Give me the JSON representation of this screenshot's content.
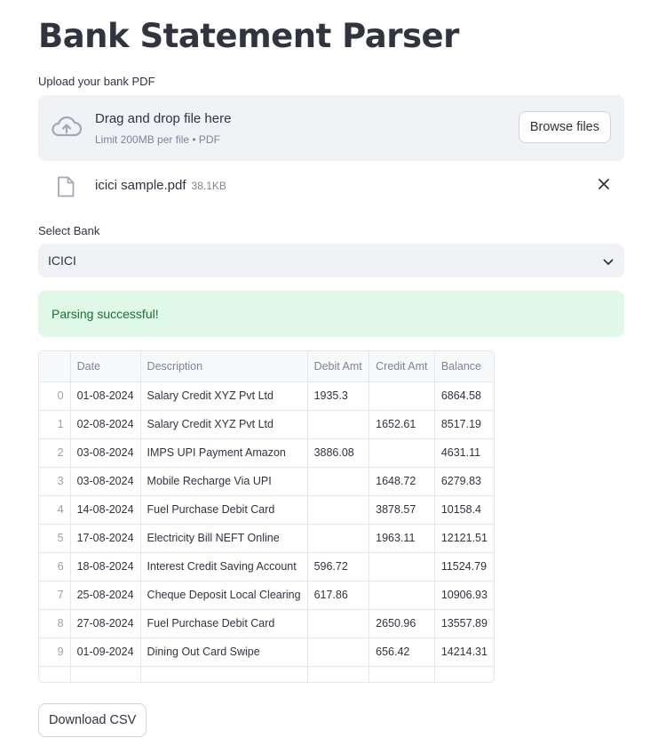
{
  "page": {
    "title": "Bank Statement Parser"
  },
  "upload": {
    "label": "Upload your bank PDF",
    "drag_text": "Drag and drop file here",
    "limit_text": "Limit 200MB per file • PDF",
    "browse_label": "Browse files",
    "file": {
      "name": "icici sample.pdf",
      "size": "38.1KB"
    }
  },
  "bank_select": {
    "label": "Select Bank",
    "value": "ICICI"
  },
  "status": {
    "message": "Parsing successful!"
  },
  "table": {
    "columns": [
      "",
      "Date",
      "Description",
      "Debit Amt",
      "Credit Amt",
      "Balance"
    ],
    "rows": [
      [
        "0",
        "01-08-2024",
        "Salary Credit XYZ Pvt Ltd",
        "1935.3",
        "",
        "6864.58"
      ],
      [
        "1",
        "02-08-2024",
        "Salary Credit XYZ Pvt Ltd",
        "",
        "1652.61",
        "8517.19"
      ],
      [
        "2",
        "03-08-2024",
        "IMPS UPI Payment Amazon",
        "3886.08",
        "",
        "4631.11"
      ],
      [
        "3",
        "03-08-2024",
        "Mobile Recharge Via UPI",
        "",
        "1648.72",
        "6279.83"
      ],
      [
        "4",
        "14-08-2024",
        "Fuel Purchase Debit Card",
        "",
        "3878.57",
        "10158.4"
      ],
      [
        "5",
        "17-08-2024",
        "Electricity Bill NEFT Online",
        "",
        "1963.11",
        "12121.51"
      ],
      [
        "6",
        "18-08-2024",
        "Interest Credit Saving Account",
        "596.72",
        "",
        "11524.79"
      ],
      [
        "7",
        "25-08-2024",
        "Cheque Deposit Local Clearing",
        "617.86",
        "",
        "10906.93"
      ],
      [
        "8",
        "27-08-2024",
        "Fuel Purchase Debit Card",
        "",
        "2650.96",
        "13557.89"
      ],
      [
        "9",
        "01-09-2024",
        "Dining Out Card Swipe",
        "",
        "656.42",
        "14214.31"
      ]
    ]
  },
  "download": {
    "label": "Download CSV"
  },
  "icons": {
    "upload": "cloud-upload-icon",
    "file": "file-icon",
    "remove": "close-icon",
    "dropdown": "chevron-down-icon"
  },
  "colors": {
    "success_bg": "#dff8e8",
    "success_text": "#177233",
    "panel_bg": "#f0f2f6"
  }
}
